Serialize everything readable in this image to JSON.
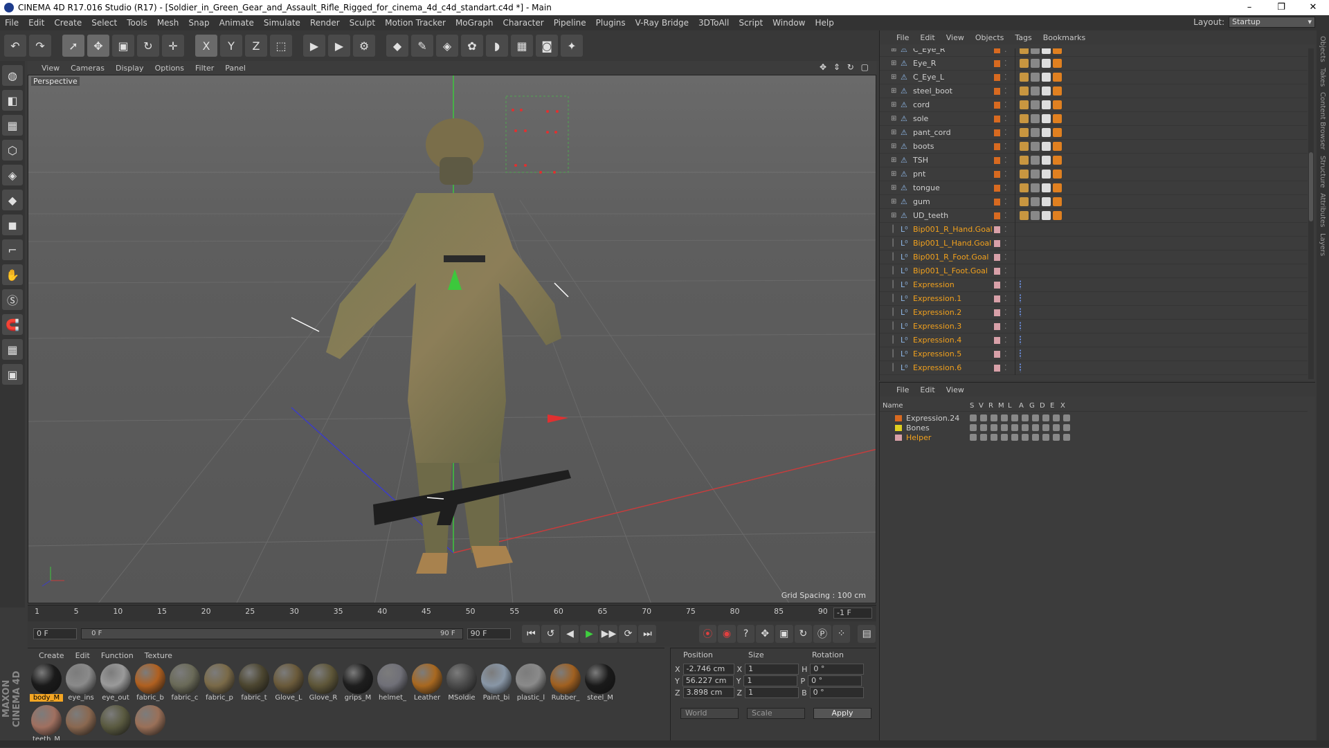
{
  "window": {
    "title": "CINEMA 4D R17.016 Studio (R17) - [Soldier_in_Green_Gear_and_Assault_Rifle_Rigged_for_cinema_4d_c4d_standart.c4d *] - Main",
    "controls": [
      "–",
      "❐",
      "✕"
    ]
  },
  "menu": [
    "File",
    "Edit",
    "Create",
    "Select",
    "Tools",
    "Mesh",
    "Snap",
    "Animate",
    "Simulate",
    "Render",
    "Sculpt",
    "Motion Tracker",
    "MoGraph",
    "Character",
    "Pipeline",
    "Plugins",
    "V-Ray Bridge",
    "3DToAll",
    "Script",
    "Window",
    "Help"
  ],
  "layout": {
    "label": "Layout:",
    "value": "Startup"
  },
  "toolbar": [
    {
      "name": "undo",
      "glyph": "↶"
    },
    {
      "name": "redo",
      "glyph": "↷"
    },
    {
      "name": "sep"
    },
    {
      "name": "live-select",
      "glyph": "➚",
      "active": true
    },
    {
      "name": "move",
      "glyph": "✥",
      "active": true
    },
    {
      "name": "scale",
      "glyph": "▣"
    },
    {
      "name": "rotate",
      "glyph": "↻"
    },
    {
      "name": "move-alt",
      "glyph": "✛"
    },
    {
      "name": "sep"
    },
    {
      "name": "x-axis",
      "glyph": "X",
      "active": true
    },
    {
      "name": "y-axis",
      "glyph": "Y"
    },
    {
      "name": "z-axis",
      "glyph": "Z"
    },
    {
      "name": "coordinate-system",
      "glyph": "⬚"
    },
    {
      "name": "sep"
    },
    {
      "name": "render-view",
      "glyph": "▶"
    },
    {
      "name": "render-picture",
      "glyph": "▶"
    },
    {
      "name": "render-settings",
      "glyph": "⚙"
    },
    {
      "name": "sep"
    },
    {
      "name": "cube",
      "glyph": "◆"
    },
    {
      "name": "pen",
      "glyph": "✎"
    },
    {
      "name": "subdivision",
      "glyph": "◈"
    },
    {
      "name": "cloner",
      "glyph": "✿"
    },
    {
      "name": "deformer",
      "glyph": "◗"
    },
    {
      "name": "floor",
      "glyph": "▦"
    },
    {
      "name": "camera",
      "glyph": "◙"
    },
    {
      "name": "light",
      "glyph": "✦"
    }
  ],
  "left_tools": [
    "make-editable",
    "model",
    "texture",
    "workplane",
    "points",
    "edges",
    "polygons",
    "axis",
    "tweak",
    "solo",
    "snap",
    "grid-snap",
    "lock"
  ],
  "viewport": {
    "menu": [
      "View",
      "Cameras",
      "Display",
      "Options",
      "Filter",
      "Panel"
    ],
    "label": "Perspective",
    "grid_spacing": "Grid Spacing : 100 cm",
    "nav_icons": "✥ ⇕ ↻ ▢"
  },
  "timeline": {
    "ticks": [
      "1",
      "5",
      "10",
      "15",
      "20",
      "25",
      "30",
      "35",
      "40",
      "45",
      "50",
      "55",
      "60",
      "65",
      "70",
      "75",
      "80",
      "85",
      "90"
    ],
    "frame_end": "-1 F"
  },
  "transport": {
    "start": "0 F",
    "range_start": "0 F",
    "range_end": "90 F",
    "end": "90 F",
    "buttons": [
      "⏮",
      "↺",
      "◀",
      "▶",
      "▶▶",
      "⟳",
      "⏭"
    ]
  },
  "materials": {
    "menu": [
      "Create",
      "Edit",
      "Function",
      "Texture"
    ],
    "items": [
      {
        "label": "body_M",
        "color": "#1a1a1a",
        "selected": true
      },
      {
        "label": "eye_ins",
        "color": "#8a8a8a"
      },
      {
        "label": "eye_out",
        "color": "#9a9a9a"
      },
      {
        "label": "fabric_b",
        "color": "#b06020"
      },
      {
        "label": "fabric_c",
        "color": "#6a6a58"
      },
      {
        "label": "fabric_p",
        "color": "#7a6a48"
      },
      {
        "label": "fabric_t",
        "color": "#4c4630"
      },
      {
        "label": "Glove_L",
        "color": "#6a5a3a"
      },
      {
        "label": "Glove_R",
        "color": "#5e5638"
      },
      {
        "label": "grips_M",
        "color": "#1e1e1e"
      },
      {
        "label": "helmet_",
        "color": "#707078"
      },
      {
        "label": "Leather",
        "color": "#a86820"
      },
      {
        "label": "MSoldie",
        "color": "#4a4a4a"
      },
      {
        "label": "Paint_bi",
        "color": "#8896a6"
      },
      {
        "label": "plastic_l",
        "color": "#8a8a8a"
      },
      {
        "label": "Rubber_",
        "color": "#a06020"
      },
      {
        "label": "steel_M",
        "color": "#1a1a1a"
      },
      {
        "label": "teeth_M",
        "color": "#a07060"
      },
      {
        "label": "",
        "color": "#8a6850"
      },
      {
        "label": "",
        "color": "#5a5a40"
      },
      {
        "label": "",
        "color": "#9a7058"
      }
    ]
  },
  "brand": "MAXON CINEMA 4D",
  "coords": {
    "headers": [
      "Position",
      "Size",
      "Rotation"
    ],
    "rows": [
      {
        "axis": "X",
        "pos": "-2.746 cm",
        "saxis": "X",
        "size": "1",
        "raxis": "H",
        "rot": "0 °"
      },
      {
        "axis": "Y",
        "pos": "56.227 cm",
        "saxis": "Y",
        "size": "1",
        "raxis": "P",
        "rot": "0 °"
      },
      {
        "axis": "Z",
        "pos": "3.898 cm",
        "saxis": "Z",
        "size": "1",
        "raxis": "B",
        "rot": "0 °"
      }
    ],
    "world": "World",
    "scale": "Scale",
    "apply": "Apply"
  },
  "objects": {
    "menu": [
      "File",
      "Edit",
      "View",
      "Objects",
      "Tags",
      "Bookmarks"
    ],
    "rows": [
      {
        "name": "C_Eye_R",
        "type": "mesh",
        "layer": "#d86a20"
      },
      {
        "name": "Eye_R",
        "type": "mesh",
        "layer": "#d86a20"
      },
      {
        "name": "C_Eye_L",
        "type": "mesh",
        "layer": "#d86a20"
      },
      {
        "name": "steel_boot",
        "type": "mesh",
        "layer": "#d86a20"
      },
      {
        "name": "cord",
        "type": "mesh",
        "layer": "#d86a20"
      },
      {
        "name": "sole",
        "type": "mesh",
        "layer": "#d86a20"
      },
      {
        "name": "pant_cord",
        "type": "mesh",
        "layer": "#d86a20"
      },
      {
        "name": "boots",
        "type": "mesh",
        "layer": "#d86a20"
      },
      {
        "name": "TSH",
        "type": "mesh",
        "layer": "#d86a20"
      },
      {
        "name": "pnt",
        "type": "mesh",
        "layer": "#d86a20"
      },
      {
        "name": "tongue",
        "type": "mesh",
        "layer": "#d86a20"
      },
      {
        "name": "gum",
        "type": "mesh",
        "layer": "#d86a20"
      },
      {
        "name": "UD_teeth",
        "type": "mesh",
        "layer": "#d86a20"
      },
      {
        "name": "Bip001_R_Hand.Goal",
        "type": "null",
        "layer": "#d8a0a8"
      },
      {
        "name": "Bip001_L_Hand.Goal",
        "type": "null",
        "layer": "#d8a0a8"
      },
      {
        "name": "Bip001_R_Foot.Goal",
        "type": "null",
        "layer": "#d8a0a8"
      },
      {
        "name": "Bip001_L_Foot.Goal",
        "type": "null",
        "layer": "#d8a0a8"
      },
      {
        "name": "Expression",
        "type": "expr",
        "layer": "#d8a0a8"
      },
      {
        "name": "Expression.1",
        "type": "expr",
        "layer": "#d8a0a8"
      },
      {
        "name": "Expression.2",
        "type": "expr",
        "layer": "#d8a0a8"
      },
      {
        "name": "Expression.3",
        "type": "expr",
        "layer": "#d8a0a8"
      },
      {
        "name": "Expression.4",
        "type": "expr",
        "layer": "#d8a0a8"
      },
      {
        "name": "Expression.5",
        "type": "expr",
        "layer": "#d8a0a8"
      },
      {
        "name": "Expression.6",
        "type": "expr",
        "layer": "#d8a0a8"
      }
    ]
  },
  "layers": {
    "menu": [
      "File",
      "Edit",
      "View"
    ],
    "headers": [
      "Name",
      "S",
      "V",
      "R",
      "M",
      "L",
      "A",
      "G",
      "D",
      "E",
      "X"
    ],
    "rows": [
      {
        "name": "Expression.24",
        "color": "#d86a20",
        "highlight": false
      },
      {
        "name": "Bones",
        "color": "#e0d020",
        "highlight": false
      },
      {
        "name": "Helper",
        "color": "#d8a0a8",
        "highlight": true
      }
    ]
  },
  "side_tabs": [
    "Objects",
    "Takes",
    "Content Browser",
    "Structure",
    "Attributes",
    "Layers"
  ]
}
